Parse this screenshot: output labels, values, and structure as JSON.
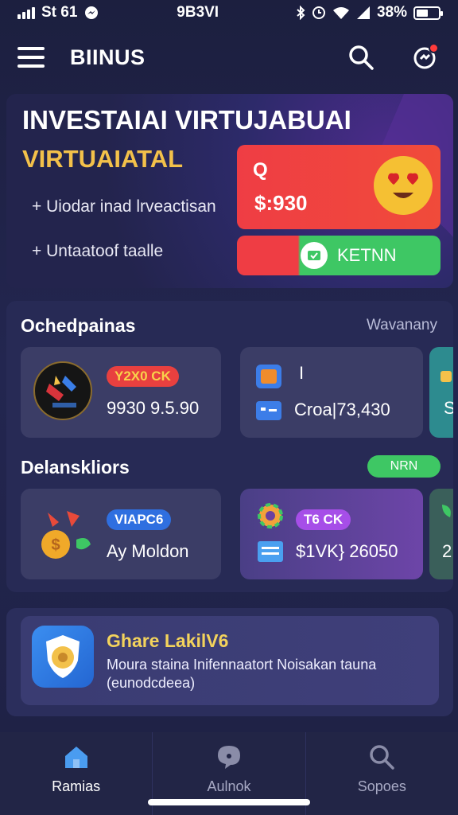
{
  "status_bar": {
    "carrier": "St 61",
    "time": "9B3VI",
    "battery": "38%"
  },
  "header": {
    "title": "BIINUS",
    "search_icon": "search-icon",
    "notification_icon": "notification-icon"
  },
  "hero": {
    "title": "INVESTAIAI VIRTUJABUAI",
    "subtitle": "VIRTUAIATAL",
    "bullets": [
      "+ Uiodar inad lrveactisan",
      "+ Untaatoof taalle"
    ],
    "balance_symbol": "Q",
    "balance_amount": "$:930",
    "action_label": "KETNN"
  },
  "sections": {
    "first": {
      "title": "Ochedpainas",
      "see_all": "Wavanany",
      "cards": [
        {
          "tag": "Y2X0 CK",
          "value": "9930 9.5.90"
        },
        {
          "tag": "I",
          "value": "Croa|73,430"
        },
        {
          "value": "S"
        }
      ]
    },
    "second": {
      "title": "Delanskliors",
      "badge": "NRN",
      "cards": [
        {
          "tag": "VIAPC6",
          "value": "Ay Moldon"
        },
        {
          "tag": "T6 CK",
          "value": "$1VK} 26050"
        },
        {
          "value": "2"
        }
      ]
    }
  },
  "promo": {
    "title": "Ghare LakilV6",
    "description": "Moura staina Inifennaatort Noisakan tauna (eunodcdeea)"
  },
  "bottom_nav": {
    "items": [
      {
        "label": "Ramias",
        "icon": "home-icon"
      },
      {
        "label": "Aulnok",
        "icon": "chat-icon"
      },
      {
        "label": "Sopoes",
        "icon": "search-icon"
      }
    ]
  },
  "colors": {
    "accent_yellow": "#f3c14a",
    "accent_red": "#ef3d44",
    "accent_green": "#3ec764",
    "background": "#1c1f3f"
  }
}
